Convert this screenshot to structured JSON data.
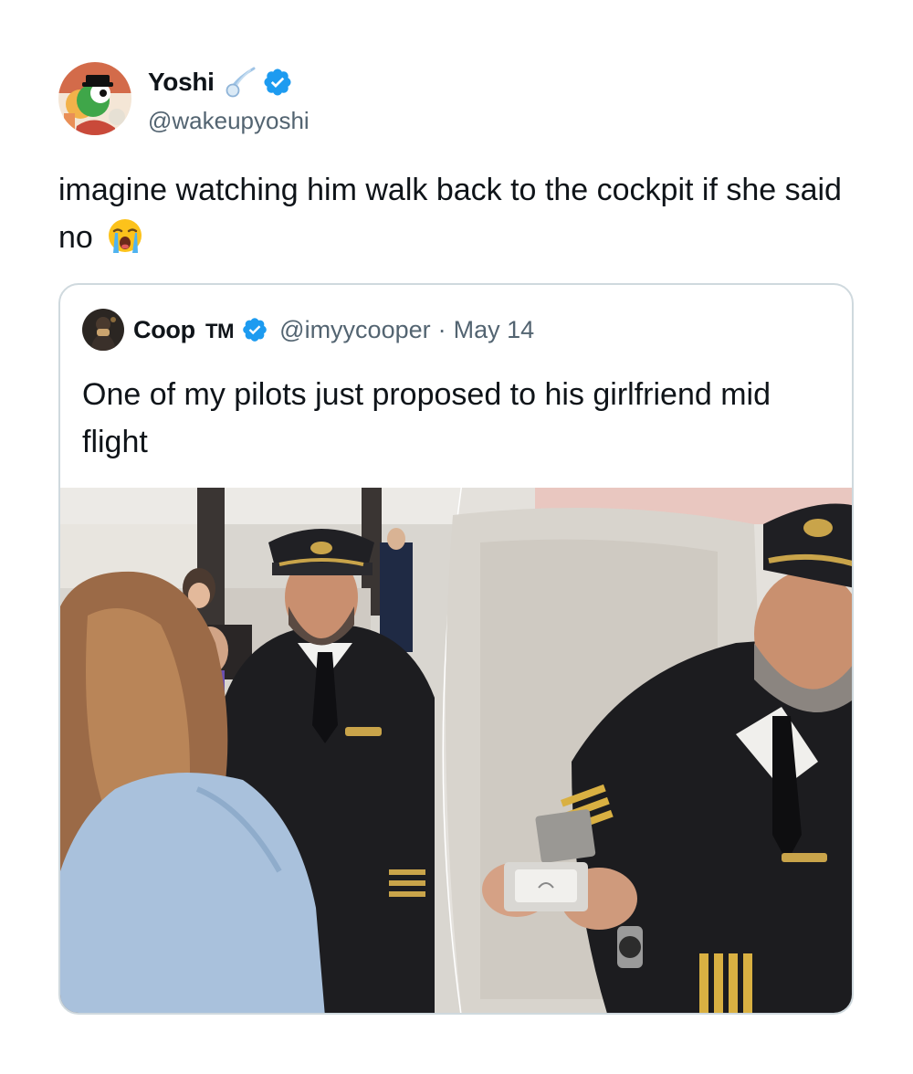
{
  "tweet": {
    "author": {
      "display_name": "Yoshi",
      "handle": "@wakeupyoshi",
      "badge_icon": "comet-icon",
      "verified_icon": "verified-icon",
      "verified_color": "#1d9bf0"
    },
    "text": "imagine watching him walk back to the cockpit if she said no",
    "emoji": "loudly-crying-face-icon"
  },
  "quoted_tweet": {
    "author": {
      "display_name": "Coop",
      "suffix": "TM",
      "handle": "@imyycooper",
      "verified_icon": "verified-icon"
    },
    "separator": "·",
    "date": "May 14",
    "text": "One of my pilots just proposed to his girlfriend mid flight",
    "media": {
      "icon": "photo-collage",
      "panels": [
        "left-photo",
        "right-photo"
      ]
    }
  },
  "colors": {
    "text": "#0f1419",
    "secondary": "#536471",
    "border": "#cfd9de",
    "accent": "#1d9bf0"
  }
}
